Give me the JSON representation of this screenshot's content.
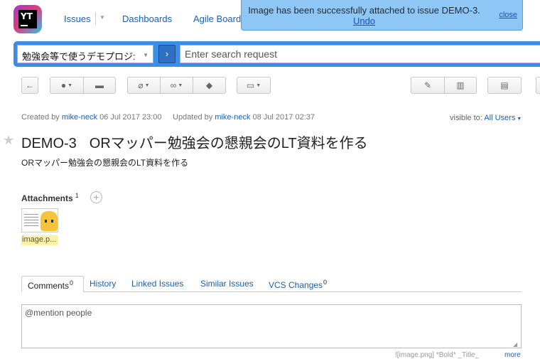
{
  "nav": {
    "logo_text": "YT",
    "items": [
      "Issues",
      "Dashboards",
      "Agile Boards"
    ]
  },
  "notification": {
    "message": "Image has been successfully attached to issue DEMO-3.",
    "undo": "Undo",
    "close": "close"
  },
  "search": {
    "project": "勉強会等で使うデモプロジ:",
    "placeholder": "Enter search request"
  },
  "meta": {
    "created_label": "Created by",
    "created_user": "mike-neck",
    "created_date": "06 Jul 2017 23:00",
    "updated_label": "Updated by",
    "updated_user": "mike-neck",
    "updated_date": "08 Jul 2017 02:37",
    "visible_label": "visible to:",
    "visible_value": "All Users"
  },
  "issue": {
    "id": "DEMO-3",
    "title": "ORマッパー勉強会の懇親会のLT資料を作る",
    "description": "ORマッパー勉強会の懇親会のLT資料を作る"
  },
  "attachments": {
    "heading": "Attachments",
    "count": "1",
    "file_label": "image.p..."
  },
  "tabs": [
    {
      "label": "Comments",
      "count": "0"
    },
    {
      "label": "History",
      "count": ""
    },
    {
      "label": "Linked Issues",
      "count": ""
    },
    {
      "label": "Similar Issues",
      "count": ""
    },
    {
      "label": "VCS Changes",
      "count": "0"
    }
  ],
  "comment": {
    "placeholder": "@mention people",
    "footer_left": "",
    "footer_hints": "![image.png]   *Bold*   _Title_",
    "footer_more": "more"
  },
  "colors": {
    "accent": "#3a8ee6",
    "link": "#1a5fb4",
    "notification": "#8ec6f5"
  }
}
